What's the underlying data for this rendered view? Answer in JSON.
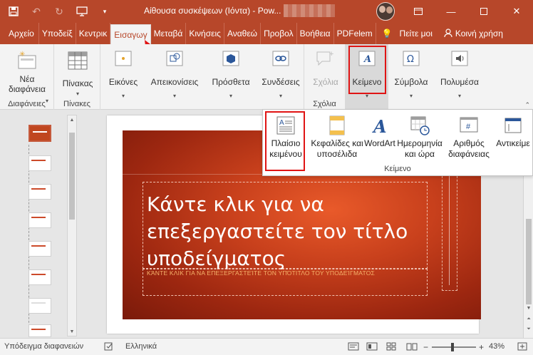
{
  "window": {
    "title": "Αίθουσα συσκέψεων (Ιόντα) - Pow...",
    "accent": "#b7472a"
  },
  "qat": {
    "save_icon": "save-icon",
    "undo_icon": "undo-icon",
    "redo_icon": "redo-icon",
    "present_icon": "present-icon",
    "more_icon": "customize-icon"
  },
  "tabs": [
    {
      "label": "Αρχείο"
    },
    {
      "label": "Υποδείξ"
    },
    {
      "label": "Κεντρικ"
    },
    {
      "label": "Εισαγωγ"
    },
    {
      "label": "Μεταβά"
    },
    {
      "label": "Κινήσεις"
    },
    {
      "label": "Αναθεώ"
    },
    {
      "label": "Προβολ"
    },
    {
      "label": "Βοήθεια"
    },
    {
      "label": "PDFelem"
    },
    {
      "label": "Πείτε μοι"
    },
    {
      "label": "Κοινή χρήση"
    }
  ],
  "ribbon": {
    "new_slide": "Νέα διαφάνεια",
    "slides_group": "Διαφάνειες",
    "table": "Πίνακας",
    "tables_group": "Πίνακες",
    "images": "Εικόνες",
    "illustrations": "Απεικονίσεις",
    "addins": "Πρόσθετα",
    "links": "Συνδέσεις",
    "comment": "Σχόλια",
    "comments_group": "Σχόλια",
    "text": "Κείμενο",
    "symbols": "Σύμβολα",
    "media": "Πολυμέσα"
  },
  "dropdown": {
    "textbox": "Πλαίσιο κειμένου",
    "header_footer": "Κεφαλίδες και υποσέλιδα",
    "wordart": "WordArt",
    "date_time": "Ημερομηνία και ώρα",
    "slide_number": "Αριθμός διαφάνειας",
    "object": "Αντικείμε",
    "group_label": "Κείμενο"
  },
  "slide": {
    "title": "Κάντε κλικ για να επεξεργαστείτε τον τίτλο υποδείγματος",
    "subtitle": "ΚΆΝΤΕ ΚΛΙΚ ΓΙΑ ΝΑ ΕΠΕΞΕΡΓΑΣΤΕΊΤΕ ΤΟΝ ΥΠΌΤΙΤΛΟ ΤΟΥ ΥΠΟΔΕΊΓΜΑΤΟΣ"
  },
  "status": {
    "view": "Υπόδειγμα διαφανειών",
    "language": "Ελληνικά",
    "zoom": "43%"
  }
}
